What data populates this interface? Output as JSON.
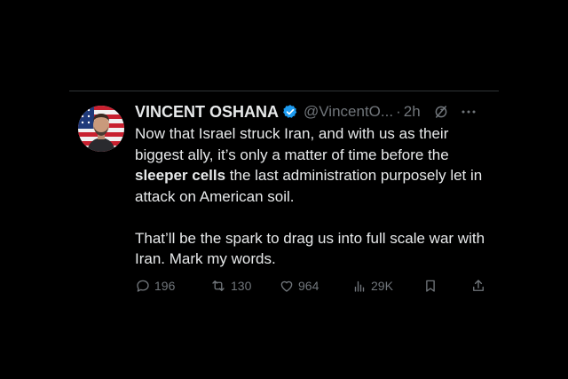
{
  "tweet": {
    "display_name": "VINCENT OSHANA",
    "handle": "@VincentO...",
    "separator": "·",
    "time": "2h",
    "text": {
      "line_a_before": "Now that Israel struck Iran, and with us as their biggest ally, it’s only a matter of time before the ",
      "line_a_bold": "sleeper cells",
      "line_a_after": " the last administration purposely let in attack on American soil.",
      "paragraph_2": "That’ll be the spark to drag us into full scale war with Iran. Mark my words."
    },
    "icons": {
      "verified": "verified-badge-icon",
      "grok": "grok-icon",
      "more": "more-icon"
    }
  },
  "actions": {
    "replies": "196",
    "reposts": "130",
    "likes": "964",
    "views": "29K",
    "icons": [
      "reply-icon",
      "repost-icon",
      "like-icon",
      "views-icon",
      "bookmark-icon",
      "share-icon"
    ]
  },
  "colors": {
    "background": "#000000",
    "text": "#e7e9ea",
    "secondary": "#71767b",
    "verified": "#1d9bf0",
    "divider": "#2f3336"
  }
}
